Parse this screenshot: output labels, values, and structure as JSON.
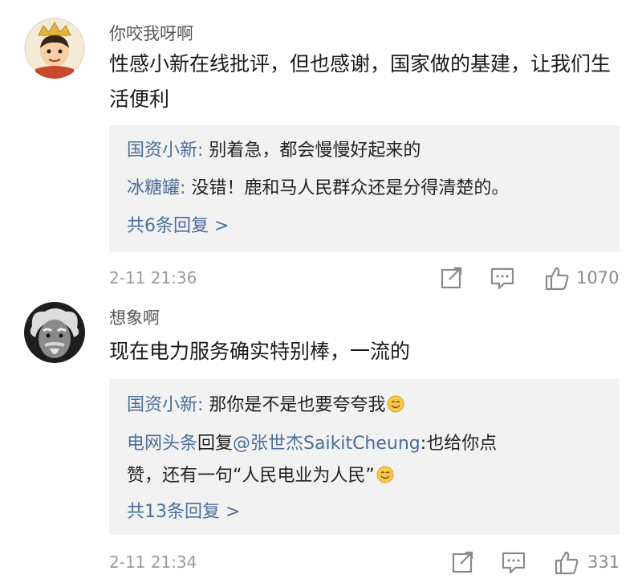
{
  "comments": [
    {
      "username": "你咬我呀啊",
      "text": "性感小新在线批评，但也感谢，国家做的基建，让我们生活便利",
      "replies": [
        {
          "author": "国资小新",
          "sep": ": ",
          "text": "别着急，都会慢慢好起来的"
        },
        {
          "author": "冰糖罐",
          "sep": ": ",
          "text": "没错！鹿和马人民群众还是分得清楚的。"
        }
      ],
      "more_replies": "共6条回复 >",
      "time": "2-11 21:36",
      "like_count": "1070",
      "icons": {
        "share": "share-icon",
        "comment": "comment-icon",
        "like": "thumbs-up-icon"
      }
    },
    {
      "username": "想象啊",
      "text": "现在电力服务确实特别棒，一流的",
      "replies": [
        {
          "author": "国资小新",
          "sep": ": ",
          "text": "那你是不是也要夸夸我",
          "emoji": "smile-emoji"
        },
        {
          "author": "电网头条",
          "mid": "回复",
          "mention": "@张世杰SaikitCheung",
          "sep": ":",
          "text_line1": "也给你点",
          "text_line2": "赞，还有一句“人民电业为人民”",
          "emoji": "smile-emoji"
        }
      ],
      "more_replies": "共13条回复 >",
      "time": "2-11 21:34",
      "like_count": "331",
      "icons": {
        "share": "share-icon",
        "comment": "comment-icon",
        "like": "thumbs-up-icon"
      }
    }
  ],
  "colors": {
    "link": "#4a6e9c",
    "reply_bg": "#f2f2f2",
    "meta": "#9a9a9a"
  }
}
